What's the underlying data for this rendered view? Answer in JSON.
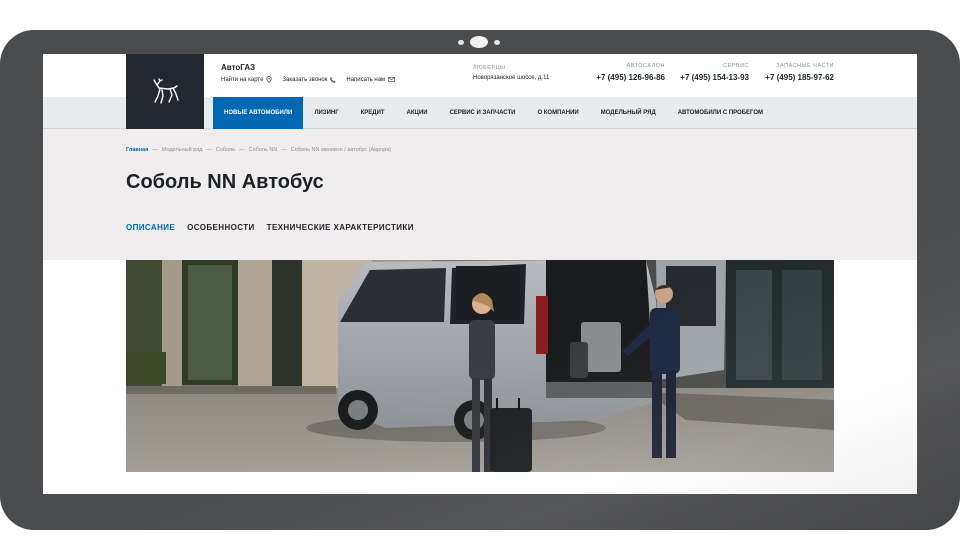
{
  "header": {
    "brand": "АвтоГАЗ",
    "links": [
      {
        "label": "Найти на карте",
        "icon": "map-pin-icon"
      },
      {
        "label": "Заказать звонок",
        "icon": "phone-icon"
      },
      {
        "label": "Написать нам",
        "icon": "mail-icon"
      }
    ],
    "location": {
      "label": "ЛЮБЕРЦЫ",
      "address": "Новорязанское шоссе, д.11"
    },
    "phones": [
      {
        "label": "АВТОСАЛОН",
        "number": "+7 (495) 126-96-86"
      },
      {
        "label": "СЕРВИС",
        "number": "+7 (495) 154-13-93"
      },
      {
        "label": "ЗАПАСНЫЕ ЧАСТИ",
        "number": "+7 (495) 185-97-62"
      }
    ]
  },
  "nav": {
    "items": [
      {
        "label": "НОВЫЕ АВТОМОБИЛИ",
        "active": true
      },
      {
        "label": "ЛИЗИНГ"
      },
      {
        "label": "КРЕДИТ"
      },
      {
        "label": "АКЦИИ"
      },
      {
        "label": "СЕРВИС И ЗАПЧАСТИ"
      },
      {
        "label": "О КОМПАНИИ"
      },
      {
        "label": "МОДЕЛЬНЫЙ РЯД"
      },
      {
        "label": "АВТОМОБИЛИ С ПРОБЕГОМ"
      }
    ]
  },
  "breadcrumb": [
    "Главная",
    "Модельный ряд",
    "Соболь",
    "Соболь NN",
    "Соболь NN минивэн / автобус (Аврора)"
  ],
  "breadcrumb_separator": "—",
  "page": {
    "title": "Соболь NN Автобус",
    "tabs": [
      {
        "label": "ОПИСАНИЕ",
        "active": true
      },
      {
        "label": "ОСОБЕННОСТИ"
      },
      {
        "label": "ТЕХНИЧЕСКИЕ ХАРАКТЕРИСТИКИ"
      }
    ]
  },
  "colors": {
    "accent": "#0067b2",
    "logo_bg": "#222830",
    "nav_bg": "#e9ecef",
    "title_bg": "#efedee",
    "device_frame": "#4a4b4d"
  }
}
